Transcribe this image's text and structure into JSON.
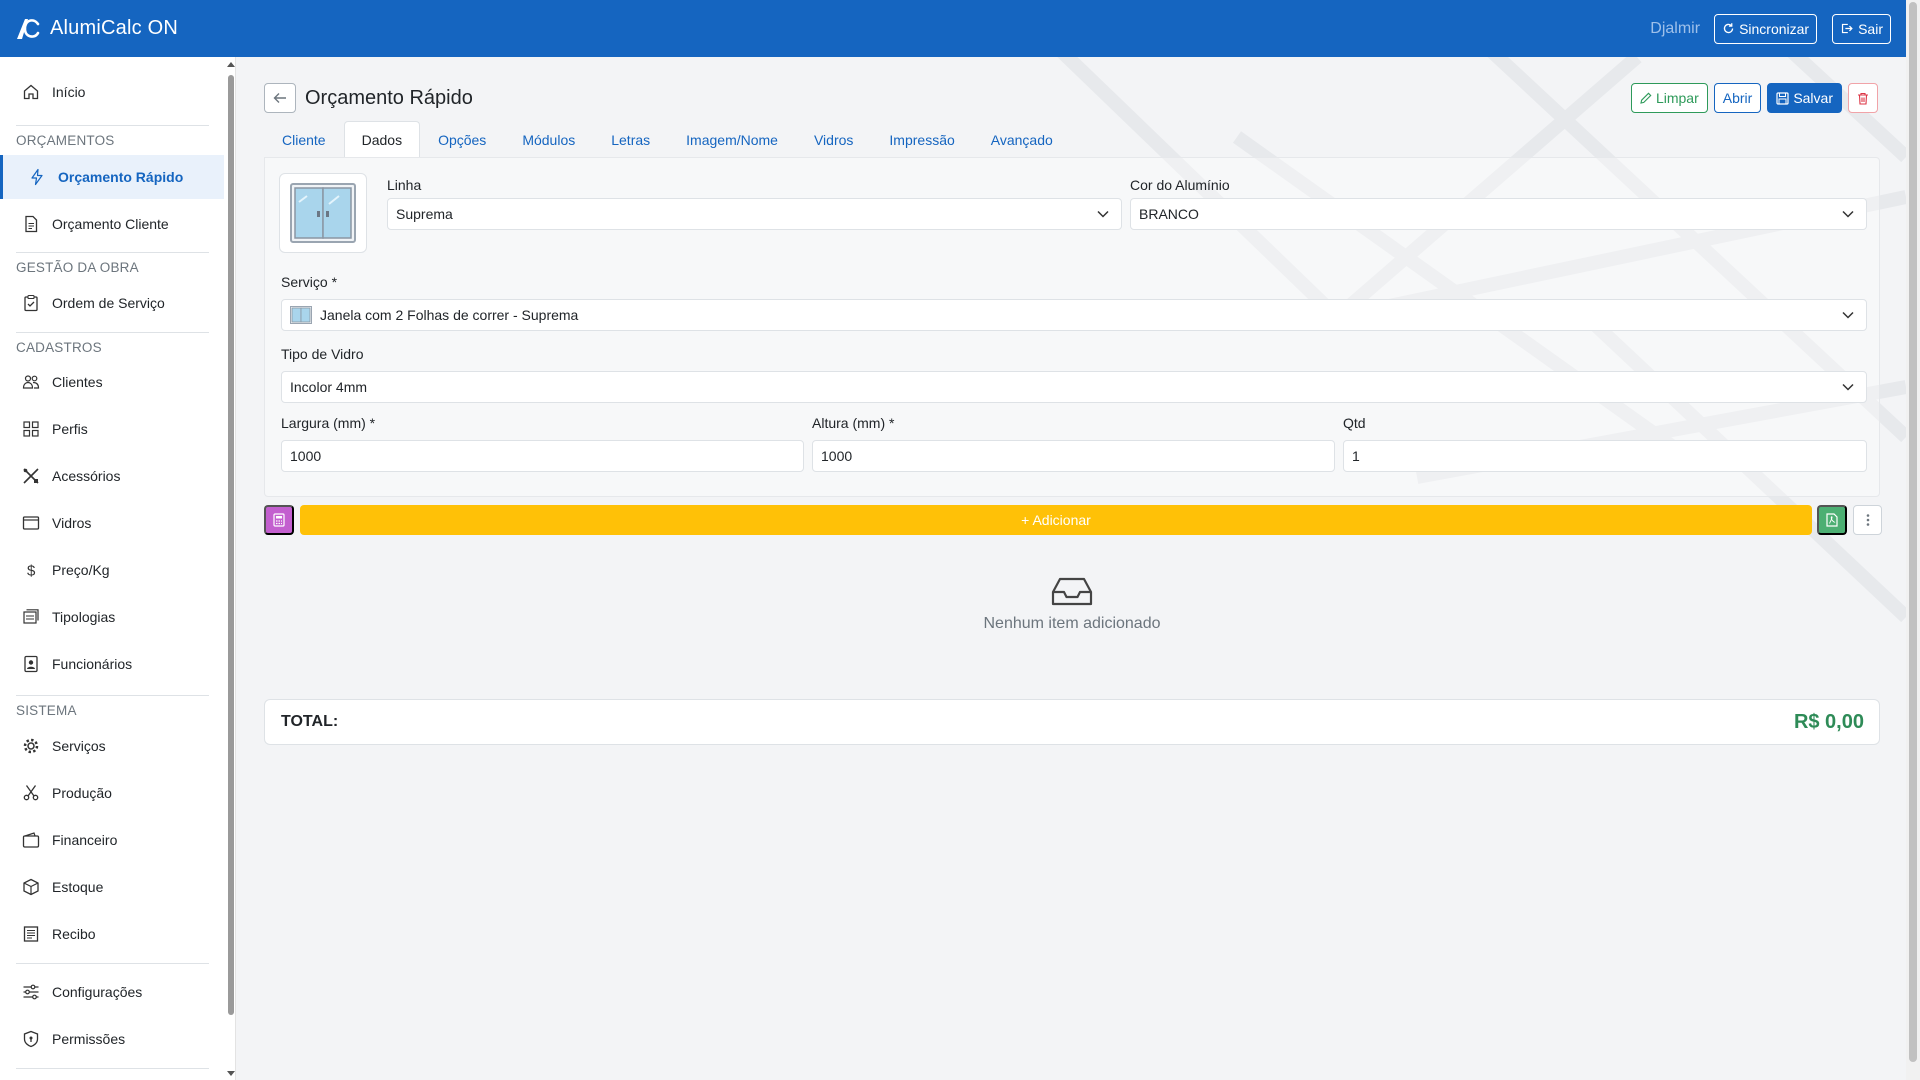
{
  "app": {
    "title": "AlumiCalc ON"
  },
  "header": {
    "user": "Djalmir",
    "sync_label": "Sincronizar",
    "logout_label": "Sair"
  },
  "sidebar": {
    "home": "Início",
    "sections": {
      "orcamentos": "ORÇAMENTOS",
      "gestao": "GESTÃO DA OBRA",
      "cadastros": "CADASTROS",
      "sistema": "SISTEMA"
    },
    "items": {
      "orcamento_rapido": "Orçamento Rápido",
      "orcamento_cliente": "Orçamento Cliente",
      "ordem_servico": "Ordem de Serviço",
      "clientes": "Clientes",
      "perfis": "Perfis",
      "acessorios": "Acessórios",
      "vidros": "Vidros",
      "preco_kg": "Preço/Kg",
      "tipologias": "Tipologias",
      "funcionarios": "Funcionários",
      "servicos": "Serviços",
      "producao": "Produção",
      "financeiro": "Financeiro",
      "estoque": "Estoque",
      "recibo": "Recibo",
      "configuracoes": "Configurações",
      "permissoes": "Permissões"
    }
  },
  "page": {
    "title": "Orçamento Rápido",
    "actions": {
      "limpar": "Limpar",
      "abrir": "Abrir",
      "salvar": "Salvar"
    },
    "tabs": [
      "Cliente",
      "Dados",
      "Opções",
      "Módulos",
      "Letras",
      "Imagem/Nome",
      "Vidros",
      "Impressão",
      "Avançado"
    ],
    "active_tab": "Dados"
  },
  "form": {
    "linha": {
      "label": "Linha",
      "value": "Suprema"
    },
    "cor": {
      "label": "Cor do Alumínio",
      "value": "BRANCO"
    },
    "servico": {
      "label": "Serviço *",
      "value": "Janela com 2 Folhas de correr - Suprema"
    },
    "tipo_vidro": {
      "label": "Tipo de Vidro",
      "value": "Incolor 4mm"
    },
    "largura": {
      "label": "Largura (mm) *",
      "value": "1000"
    },
    "altura": {
      "label": "Altura (mm) *",
      "value": "1000"
    },
    "qtd": {
      "label": "Qtd",
      "value": "1"
    }
  },
  "add_button": "+ Adicionar",
  "empty_state": "Nenhum item adicionado",
  "total": {
    "label": "TOTAL:",
    "value": "R$ 0,00"
  },
  "colors": {
    "primary": "#1565c0",
    "success": "#2e8b57",
    "warning": "#ffc107",
    "danger": "#dc3545",
    "purple": "#c35fcf"
  }
}
